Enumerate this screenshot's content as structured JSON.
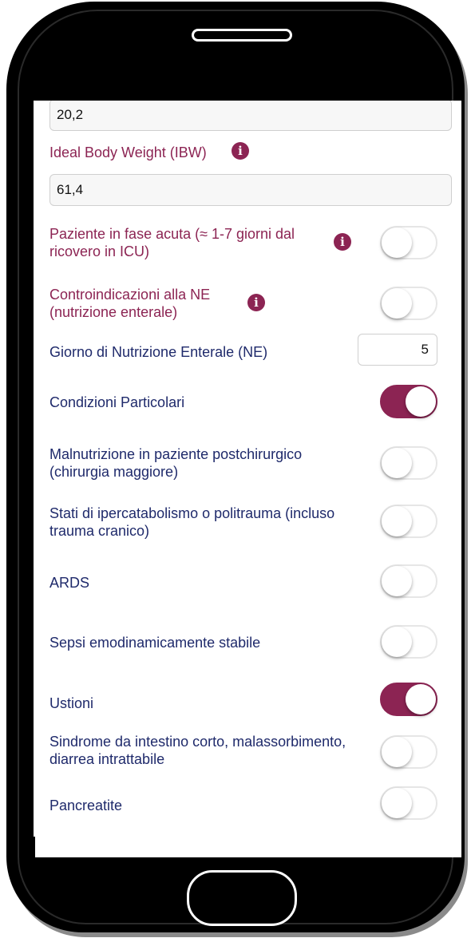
{
  "fields": {
    "bmi_value": "20,2",
    "ibw_label": "Ideal Body Weight (IBW)",
    "ibw_value": "61,4",
    "giorno_ne_label": "Giorno di Nutrizione Enterale (NE)",
    "giorno_ne_value": "5"
  },
  "toggles": [
    {
      "label": "Paziente in fase acuta (≈ 1-7 giorni dal ricovero in ICU)",
      "on": false,
      "info": true
    },
    {
      "label": "Controindicazioni alla NE (nutrizione enterale)",
      "on": false,
      "info": true
    },
    {
      "label": "Condizioni Particolari",
      "on": true
    },
    {
      "label": "Malnutrizione in paziente postchirurgico (chirurgia maggiore)",
      "on": false
    },
    {
      "label": "Stati di ipercatabolismo o politrauma (incluso trauma cranico)",
      "on": false
    },
    {
      "label": "ARDS",
      "on": false
    },
    {
      "label": "Sepsi emodinamicamente stabile",
      "on": false
    },
    {
      "label": "Ustioni",
      "on": true
    },
    {
      "label": "Sindrome da intestino corto, malassorbimento, diarrea intrattabile",
      "on": false
    },
    {
      "label": "Pancreatite",
      "on": false
    }
  ],
  "icons": {
    "info": "info-icon",
    "info_glyph": "i"
  },
  "colors": {
    "accent": "#8c2453",
    "label_text": "#1f2a6b"
  }
}
